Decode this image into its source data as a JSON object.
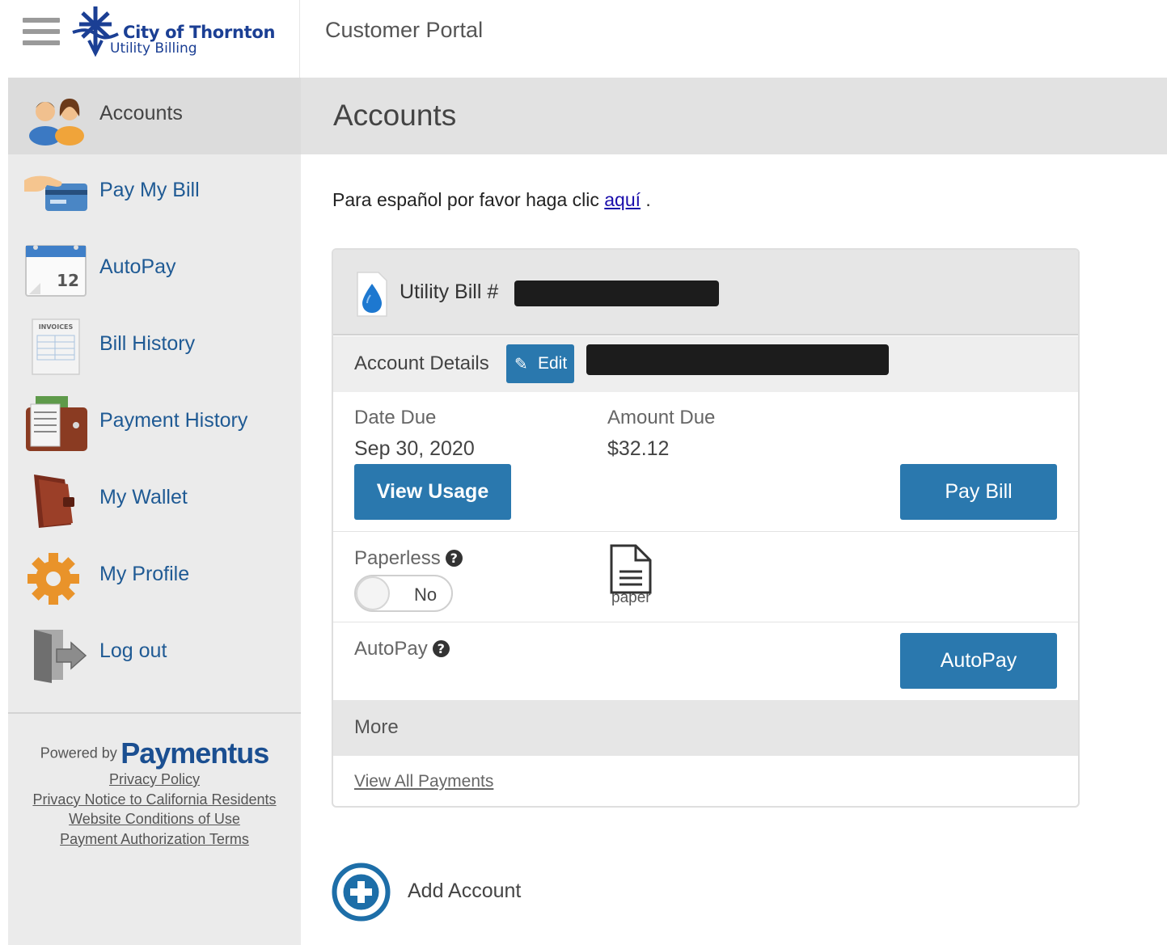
{
  "header": {
    "logo_line1": "City of Thornton",
    "logo_line2": "Utility Billing",
    "portal_title": "Customer Portal"
  },
  "sidebar": {
    "items": [
      {
        "label": "Accounts",
        "icon": "users-icon"
      },
      {
        "label": "Pay My Bill",
        "icon": "credit-card-icon"
      },
      {
        "label": "AutoPay",
        "icon": "calendar-icon"
      },
      {
        "label": "Bill History",
        "icon": "invoices-icon"
      },
      {
        "label": "Payment History",
        "icon": "receipts-icon"
      },
      {
        "label": "My Wallet",
        "icon": "wallet-icon"
      },
      {
        "label": "My Profile",
        "icon": "gear-icon"
      },
      {
        "label": "Log out",
        "icon": "logout-door-icon"
      }
    ],
    "calendar_day": "12",
    "invoices_text": "INVOICES",
    "powered_by": "Powered by",
    "brand": "Paymentus",
    "footer_links": [
      "Privacy Policy",
      "Privacy Notice to California Residents",
      "Website Conditions of Use",
      "Payment Authorization Terms"
    ]
  },
  "main": {
    "page_title": "Accounts",
    "spanish_prefix": "Para español por favor haga clic ",
    "spanish_link": "aquí",
    "spanish_suffix": " .",
    "card": {
      "bill_label": "Utility Bill #",
      "account_details_label": "Account Details",
      "edit_label": "Edit",
      "date_due_label": "Date Due",
      "date_due_value": "Sep 30, 2020",
      "amount_due_label": "Amount Due",
      "amount_due_value": "$32.12",
      "view_usage_label": "View Usage",
      "pay_bill_label": "Pay Bill",
      "paperless_label": "Paperless",
      "paperless_toggle": "No",
      "paper_label": "paper",
      "autopay_label": "AutoPay",
      "autopay_button": "AutoPay",
      "more_label": "More",
      "view_all_payments": "View All Payments"
    },
    "add_account_label": "Add Account"
  },
  "colors": {
    "primary_button": "#2a78ae",
    "brand_blue": "#1b3f94",
    "nav_link": "#1f5a94",
    "link": "#1a0dab"
  }
}
